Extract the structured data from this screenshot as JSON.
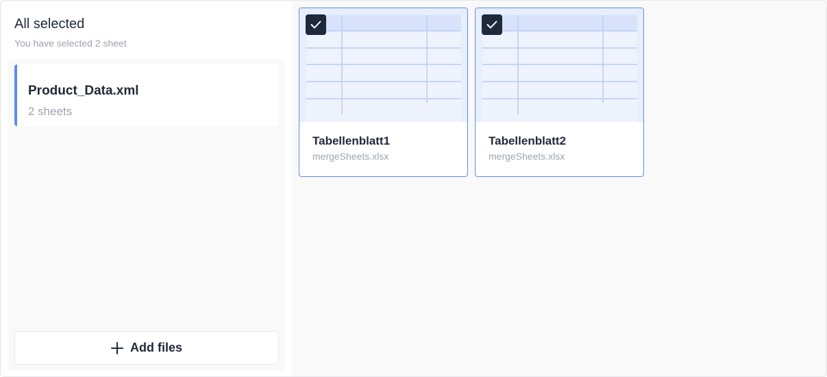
{
  "header": {
    "title": "All selected",
    "subtitle": "You have selected 2 sheet"
  },
  "files": [
    {
      "name": "Product_Data.xml",
      "sheets_label": "2 sheets"
    }
  ],
  "add_button": {
    "label": "Add files",
    "icon": "plus-icon"
  },
  "sheets": [
    {
      "name": "Tabellenblatt1",
      "file": "mergeSheets.xlsx",
      "selected": true
    },
    {
      "name": "Tabellenblatt2",
      "file": "mergeSheets.xlsx",
      "selected": true
    }
  ],
  "colors": {
    "accent": "#5b8def",
    "check_bg": "#1e293b",
    "thumb_bg": "#e7eefc",
    "thumb_header": "#d8e3fb",
    "grid_line": "#b9cdf7"
  }
}
